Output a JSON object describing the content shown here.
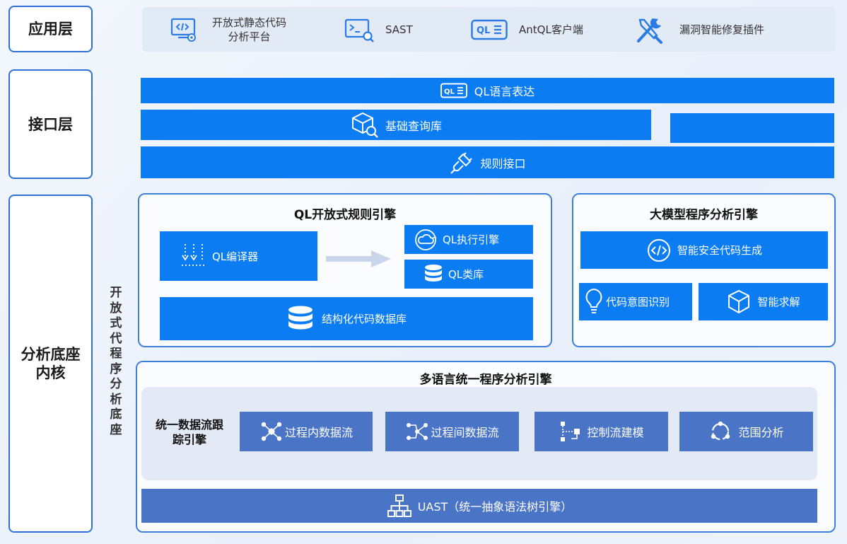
{
  "layers": {
    "app": "应用层",
    "interface": "接口层",
    "core": "分析底座\n内核"
  },
  "side_label": "开放式代程序分析底座",
  "app_items": [
    {
      "label": "开放式静态代码\n分析平台",
      "icon": "code-monitor-icon"
    },
    {
      "label": "SAST",
      "icon": "terminal-search-icon"
    },
    {
      "label": "AntQL客户端",
      "icon": "ql-badge-icon"
    },
    {
      "label": "漏洞智能修复插件",
      "icon": "tools-icon"
    }
  ],
  "interface_bars": [
    {
      "label": "QL语言表达",
      "icon": "ql-badge-icon"
    },
    {
      "label": "基础查询库",
      "icon": "box-search-icon"
    },
    {
      "label": "规则接口",
      "icon": "plug-icon"
    }
  ],
  "ql_engine": {
    "title": "QL开放式规则引擎",
    "compiler": "QL编译器",
    "executor": "QL执行引擎",
    "classlib": "QL类库",
    "database": "结构化代码数据库"
  },
  "llm_engine": {
    "title": "大模型程序分析引擎",
    "gen": "智能安全代码生成",
    "intent": "代码意图识别",
    "solve": "智能求解"
  },
  "multi_engine": {
    "title": "多语言统一程序分析引擎",
    "dataflow_label": "统一数据流跟\n踪引擎",
    "items": [
      "过程内数据流",
      "过程间数据流",
      "控制流建模",
      "范围分析"
    ],
    "uast": "UAST（统一抽象语法树引擎）"
  },
  "colors": {
    "primary": "#0b7cf2",
    "navy": "#4a74c6",
    "border": "#2f6fd6"
  }
}
